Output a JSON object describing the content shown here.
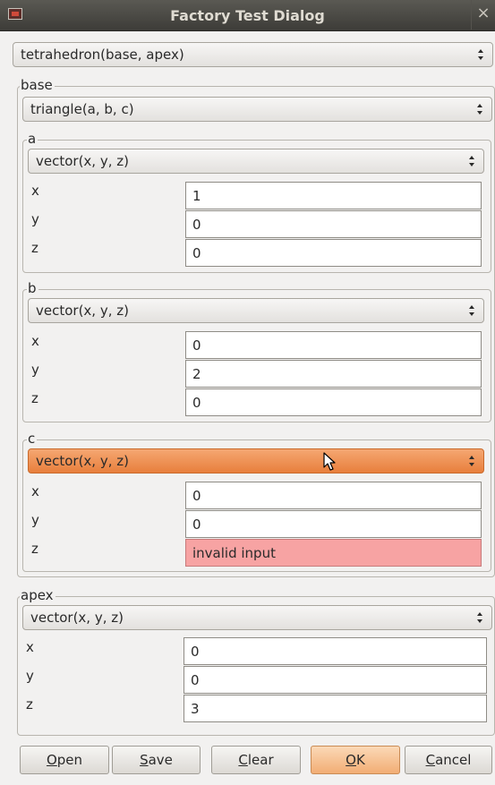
{
  "window": {
    "title": "Factory Test Dialog",
    "close_glyph": "×"
  },
  "main_combo": "tetrahedron(base, apex)",
  "base": {
    "label": "base",
    "combo": "triangle(a, b, c)",
    "a": {
      "label": "a",
      "combo": "vector(x, y, z)",
      "x_label": "x",
      "x_value": "1",
      "y_label": "y",
      "y_value": "0",
      "z_label": "z",
      "z_value": "0"
    },
    "b": {
      "label": "b",
      "combo": "vector(x, y, z)",
      "x_label": "x",
      "x_value": "0",
      "y_label": "y",
      "y_value": "2",
      "z_label": "z",
      "z_value": "0"
    },
    "c": {
      "label": "c",
      "combo": "vector(x, y, z)",
      "x_label": "x",
      "x_value": "0",
      "y_label": "y",
      "y_value": "0",
      "z_label": "z",
      "z_value": "invalid input"
    }
  },
  "apex": {
    "label": "apex",
    "combo": "vector(x, y, z)",
    "x_label": "x",
    "x_value": "0",
    "y_label": "y",
    "y_value": "0",
    "z_label": "z",
    "z_value": "3"
  },
  "buttons": {
    "open": {
      "mnemonic": "O",
      "rest": "pen"
    },
    "save": {
      "mnemonic": "S",
      "rest": "ave"
    },
    "clear": {
      "mnemonic": "C",
      "rest": "lear"
    },
    "ok": {
      "mnemonic": "O",
      "rest": "K"
    },
    "cancel": {
      "mnemonic": "C",
      "rest": "ancel"
    }
  },
  "colors": {
    "titlebar": "#4a4944",
    "hover_accent": "#f0914f",
    "invalid_background": "#f7a3a3",
    "default_button": "#f2ad74"
  },
  "icons": {
    "window_icon": "app-window-icon",
    "close": "close-icon",
    "combo_arrow": "updown-arrow-icon",
    "cursor": "mouse-pointer-icon"
  }
}
